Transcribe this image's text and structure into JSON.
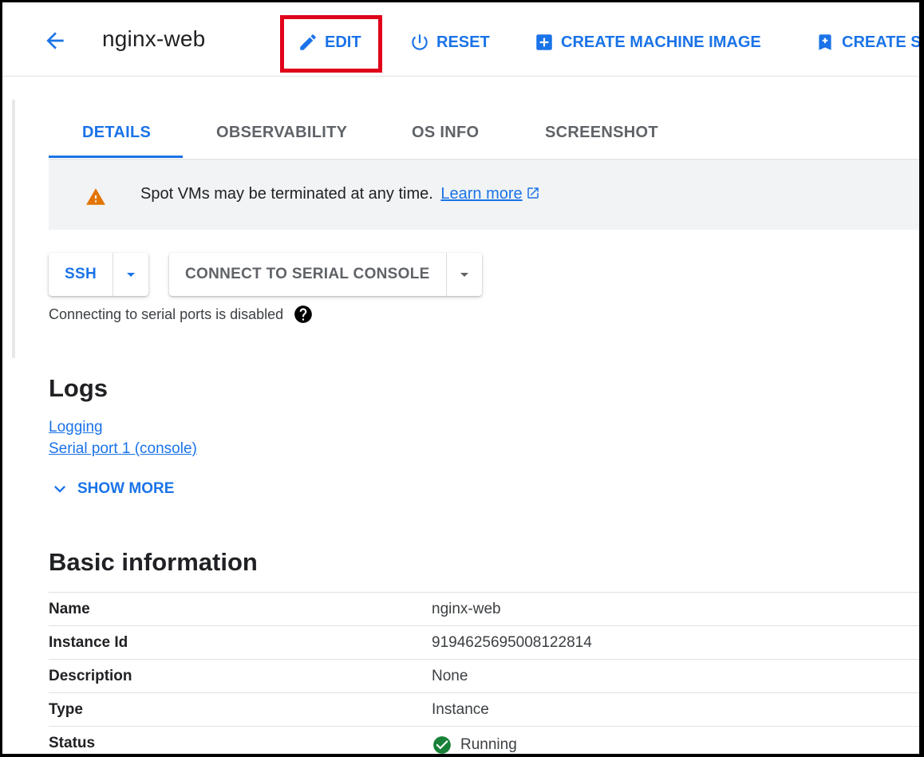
{
  "header": {
    "title": "nginx-web",
    "actions": [
      {
        "label": "EDIT"
      },
      {
        "label": "RESET"
      },
      {
        "label": "CREATE MACHINE IMAGE"
      },
      {
        "label": "CREATE S"
      }
    ]
  },
  "tabs": [
    {
      "label": "DETAILS",
      "active": true
    },
    {
      "label": "OBSERVABILITY",
      "active": false
    },
    {
      "label": "OS INFO",
      "active": false
    },
    {
      "label": "SCREENSHOT",
      "active": false
    }
  ],
  "banner": {
    "text": "Spot VMs may be terminated at any time.",
    "link": "Learn more"
  },
  "connect": {
    "ssh_label": "SSH",
    "serial_label": "CONNECT TO SERIAL CONSOLE",
    "note": "Connecting to serial ports is disabled"
  },
  "logs": {
    "heading": "Logs",
    "links": [
      "Logging",
      "Serial port 1 (console)"
    ],
    "show_more": "SHOW MORE"
  },
  "basic_info": {
    "heading": "Basic information",
    "rows": [
      {
        "key": "Name",
        "value": "nginx-web"
      },
      {
        "key": "Instance Id",
        "value": "9194625695008122814"
      },
      {
        "key": "Description",
        "value": "None"
      },
      {
        "key": "Type",
        "value": "Instance"
      },
      {
        "key": "Status",
        "value": "Running"
      }
    ]
  },
  "colors": {
    "accent": "#1a73e8",
    "highlight_box": "#e0001a",
    "warning": "#e37400",
    "success": "#188038"
  },
  "icons": [
    "back-arrow-icon",
    "pencil-icon",
    "power-icon",
    "add-box-icon",
    "warning-icon",
    "external-link-icon",
    "caret-down-icon",
    "help-icon",
    "chevron-down-icon",
    "check-circle-icon"
  ]
}
